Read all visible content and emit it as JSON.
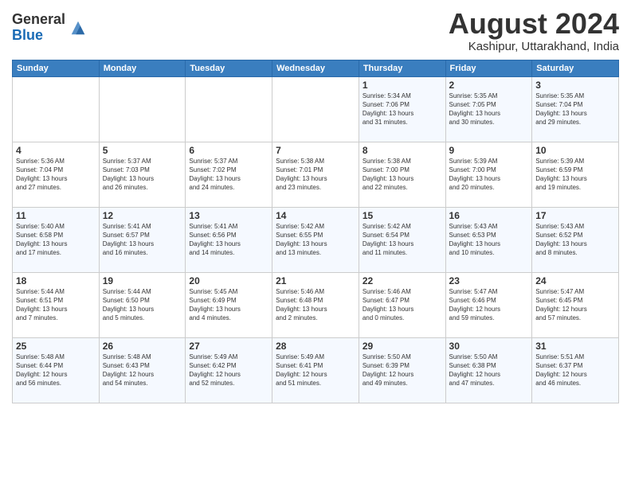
{
  "header": {
    "logo_line1": "General",
    "logo_line2": "Blue",
    "month_year": "August 2024",
    "location": "Kashipur, Uttarakhand, India"
  },
  "weekdays": [
    "Sunday",
    "Monday",
    "Tuesday",
    "Wednesday",
    "Thursday",
    "Friday",
    "Saturday"
  ],
  "weeks": [
    [
      {
        "day": "",
        "info": ""
      },
      {
        "day": "",
        "info": ""
      },
      {
        "day": "",
        "info": ""
      },
      {
        "day": "",
        "info": ""
      },
      {
        "day": "1",
        "info": "Sunrise: 5:34 AM\nSunset: 7:06 PM\nDaylight: 13 hours\nand 31 minutes."
      },
      {
        "day": "2",
        "info": "Sunrise: 5:35 AM\nSunset: 7:05 PM\nDaylight: 13 hours\nand 30 minutes."
      },
      {
        "day": "3",
        "info": "Sunrise: 5:35 AM\nSunset: 7:04 PM\nDaylight: 13 hours\nand 29 minutes."
      }
    ],
    [
      {
        "day": "4",
        "info": "Sunrise: 5:36 AM\nSunset: 7:04 PM\nDaylight: 13 hours\nand 27 minutes."
      },
      {
        "day": "5",
        "info": "Sunrise: 5:37 AM\nSunset: 7:03 PM\nDaylight: 13 hours\nand 26 minutes."
      },
      {
        "day": "6",
        "info": "Sunrise: 5:37 AM\nSunset: 7:02 PM\nDaylight: 13 hours\nand 24 minutes."
      },
      {
        "day": "7",
        "info": "Sunrise: 5:38 AM\nSunset: 7:01 PM\nDaylight: 13 hours\nand 23 minutes."
      },
      {
        "day": "8",
        "info": "Sunrise: 5:38 AM\nSunset: 7:00 PM\nDaylight: 13 hours\nand 22 minutes."
      },
      {
        "day": "9",
        "info": "Sunrise: 5:39 AM\nSunset: 7:00 PM\nDaylight: 13 hours\nand 20 minutes."
      },
      {
        "day": "10",
        "info": "Sunrise: 5:39 AM\nSunset: 6:59 PM\nDaylight: 13 hours\nand 19 minutes."
      }
    ],
    [
      {
        "day": "11",
        "info": "Sunrise: 5:40 AM\nSunset: 6:58 PM\nDaylight: 13 hours\nand 17 minutes."
      },
      {
        "day": "12",
        "info": "Sunrise: 5:41 AM\nSunset: 6:57 PM\nDaylight: 13 hours\nand 16 minutes."
      },
      {
        "day": "13",
        "info": "Sunrise: 5:41 AM\nSunset: 6:56 PM\nDaylight: 13 hours\nand 14 minutes."
      },
      {
        "day": "14",
        "info": "Sunrise: 5:42 AM\nSunset: 6:55 PM\nDaylight: 13 hours\nand 13 minutes."
      },
      {
        "day": "15",
        "info": "Sunrise: 5:42 AM\nSunset: 6:54 PM\nDaylight: 13 hours\nand 11 minutes."
      },
      {
        "day": "16",
        "info": "Sunrise: 5:43 AM\nSunset: 6:53 PM\nDaylight: 13 hours\nand 10 minutes."
      },
      {
        "day": "17",
        "info": "Sunrise: 5:43 AM\nSunset: 6:52 PM\nDaylight: 13 hours\nand 8 minutes."
      }
    ],
    [
      {
        "day": "18",
        "info": "Sunrise: 5:44 AM\nSunset: 6:51 PM\nDaylight: 13 hours\nand 7 minutes."
      },
      {
        "day": "19",
        "info": "Sunrise: 5:44 AM\nSunset: 6:50 PM\nDaylight: 13 hours\nand 5 minutes."
      },
      {
        "day": "20",
        "info": "Sunrise: 5:45 AM\nSunset: 6:49 PM\nDaylight: 13 hours\nand 4 minutes."
      },
      {
        "day": "21",
        "info": "Sunrise: 5:46 AM\nSunset: 6:48 PM\nDaylight: 13 hours\nand 2 minutes."
      },
      {
        "day": "22",
        "info": "Sunrise: 5:46 AM\nSunset: 6:47 PM\nDaylight: 13 hours\nand 0 minutes."
      },
      {
        "day": "23",
        "info": "Sunrise: 5:47 AM\nSunset: 6:46 PM\nDaylight: 12 hours\nand 59 minutes."
      },
      {
        "day": "24",
        "info": "Sunrise: 5:47 AM\nSunset: 6:45 PM\nDaylight: 12 hours\nand 57 minutes."
      }
    ],
    [
      {
        "day": "25",
        "info": "Sunrise: 5:48 AM\nSunset: 6:44 PM\nDaylight: 12 hours\nand 56 minutes."
      },
      {
        "day": "26",
        "info": "Sunrise: 5:48 AM\nSunset: 6:43 PM\nDaylight: 12 hours\nand 54 minutes."
      },
      {
        "day": "27",
        "info": "Sunrise: 5:49 AM\nSunset: 6:42 PM\nDaylight: 12 hours\nand 52 minutes."
      },
      {
        "day": "28",
        "info": "Sunrise: 5:49 AM\nSunset: 6:41 PM\nDaylight: 12 hours\nand 51 minutes."
      },
      {
        "day": "29",
        "info": "Sunrise: 5:50 AM\nSunset: 6:39 PM\nDaylight: 12 hours\nand 49 minutes."
      },
      {
        "day": "30",
        "info": "Sunrise: 5:50 AM\nSunset: 6:38 PM\nDaylight: 12 hours\nand 47 minutes."
      },
      {
        "day": "31",
        "info": "Sunrise: 5:51 AM\nSunset: 6:37 PM\nDaylight: 12 hours\nand 46 minutes."
      }
    ]
  ]
}
